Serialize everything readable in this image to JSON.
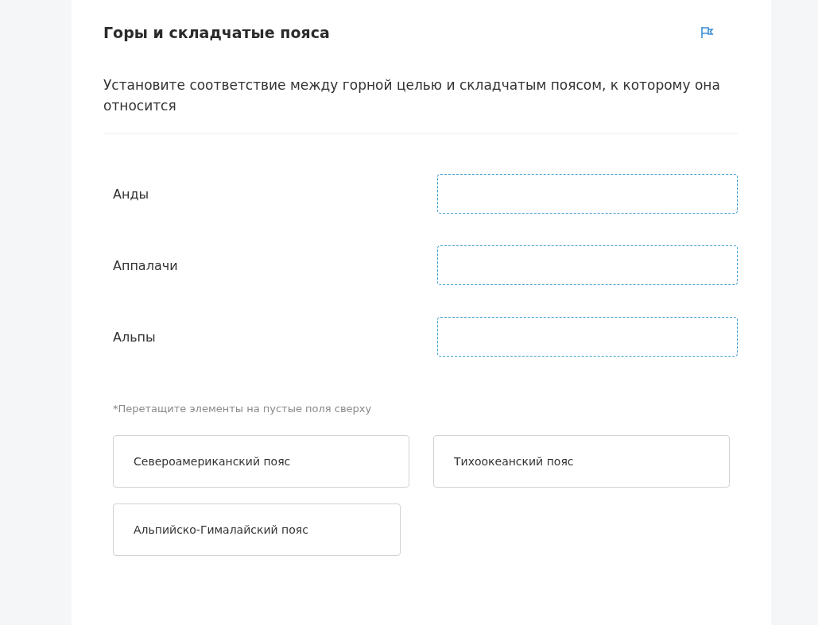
{
  "title": "Горы и складчатые пояса",
  "question": "Установите соответствие между горной целью и складчатым поясом, к которому она относится",
  "pairs": [
    {
      "label": "Анды"
    },
    {
      "label": "Аппалачи"
    },
    {
      "label": "Альпы"
    }
  ],
  "hint": "*Перетащите элементы на пустые поля сверху",
  "options": [
    {
      "label": "Североамериканский пояс"
    },
    {
      "label": "Тихоокеанский пояс"
    },
    {
      "label": "Альпийско-Гималайский пояс"
    }
  ]
}
